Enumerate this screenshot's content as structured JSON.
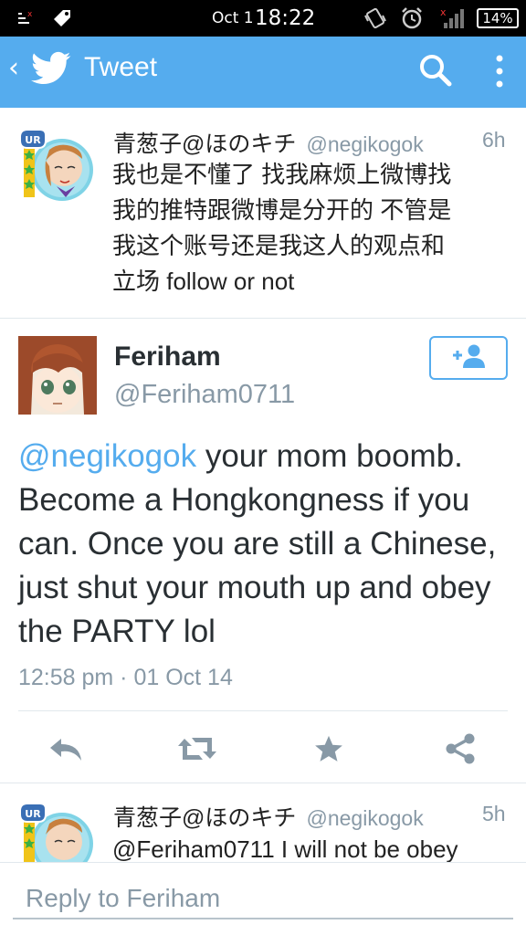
{
  "status_bar": {
    "date": "Oct 1",
    "time": "18:22",
    "battery": "14%"
  },
  "action_bar": {
    "back_symbol": "‹",
    "title": "Tweet"
  },
  "colors": {
    "twitter_blue": "#55acee",
    "text": "#292f33",
    "muted": "#8899a6",
    "divider": "#e1e8ed"
  },
  "top_tweet": {
    "name": "青葱子@ほのキチ",
    "handle": "@negikogok",
    "age": "6h",
    "lines": [
      "我也是不懂了 找我麻烦上微博找",
      "我的推特跟微博是分开的 不管是",
      "我这个账号还是我这人的观点和",
      "立场 follow or not"
    ],
    "avatar_badge": "UR"
  },
  "main_tweet": {
    "name": "Feriham",
    "handle": "@Feriham0711",
    "mention": "@negikogok",
    "text": " your mom boomb. Become a Hongkongness if you can. Once you are still a Chinese, just shut your mouth up and obey the PARTY lol",
    "timestamp": "12:58 pm · 01 Oct 14",
    "follow_icon": "add-user-icon",
    "actions": [
      "reply-icon",
      "retweet-icon",
      "favorite-icon",
      "share-icon"
    ]
  },
  "bottom_tweet": {
    "name": "青葱子@ほのキチ",
    "handle": "@negikogok",
    "age": "5h",
    "line": "@Feriham0711 I will not be obey",
    "avatar_badge": "UR"
  },
  "reply": {
    "placeholder": "Reply to Feriham"
  }
}
